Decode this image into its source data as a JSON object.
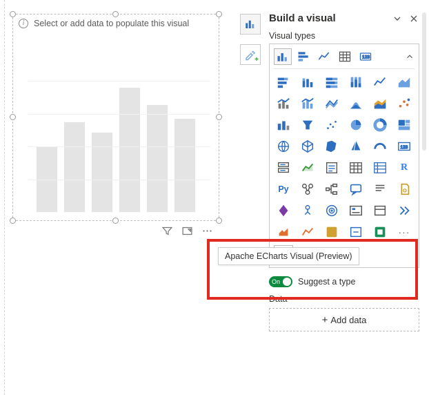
{
  "canvas": {
    "placeholder_text": "Select or add data to populate this visual",
    "ghost_bars": [
      95,
      130,
      115,
      180,
      155,
      135
    ],
    "footer_icons": [
      "filter-icon",
      "focus-mode-icon",
      "more-icon"
    ]
  },
  "mode_buttons": [
    {
      "name": "build-visual-mode",
      "active": true
    },
    {
      "name": "format-visual-mode",
      "active": false
    }
  ],
  "panel": {
    "title": "Build a visual",
    "header_icons": [
      "collapse-icon",
      "close-icon"
    ],
    "visual_types_label": "Visual types",
    "strip": [
      "clustered-column-chart",
      "clustered-bar-chart",
      "line-chart",
      "table",
      "card"
    ],
    "grid": [
      [
        "stacked-bar-chart",
        "stacked-column-chart",
        "100-stacked-bar-chart",
        "100-stacked-column-chart",
        "line-chart",
        "area-chart"
      ],
      [
        "line-clustered-column",
        "line-stacked-column",
        "ribbon-chart",
        "waterfall-chart",
        "funnel-chart",
        "scatter-chart"
      ],
      [
        "column-small-mult",
        "funnel",
        "scatter",
        "pie-chart",
        "donut-chart",
        "treemap"
      ],
      [
        "map",
        "filled-map",
        "shape-map",
        "azure-map",
        "gauge",
        "card-multi"
      ],
      [
        "multi-row-card",
        "kpi",
        "slicer",
        "table",
        "matrix",
        "r-visual"
      ],
      [
        "python-visual",
        "key-influencers",
        "decomposition-tree",
        "qna",
        "smart-narrative",
        "paginated-report"
      ],
      [
        "power-apps",
        "power-automate",
        "score-card",
        "metrics",
        "custom-a",
        "double-arrow"
      ],
      [
        "custom-b",
        "custom-c",
        "custom-d",
        "custom-e",
        "app-source",
        "more-visuals"
      ]
    ],
    "tooltip_text": "Apache ECharts Visual (Preview)",
    "suggest": {
      "on_text": "On",
      "label": "Suggest a type"
    },
    "data_label": "Data",
    "add_data_label": "Add data"
  }
}
